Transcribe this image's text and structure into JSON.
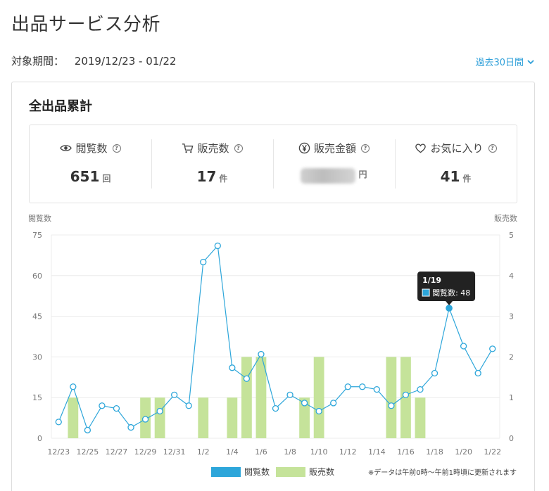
{
  "header": {
    "title": "出品サービス分析",
    "period_label": "対象期間：",
    "period_value": "2019/12/23 - 01/22",
    "range_selector": "過去30日間"
  },
  "card": {
    "title": "全出品累計",
    "stats": [
      {
        "icon": "eye-icon",
        "label": "閲覧数",
        "value": "651",
        "unit": "回"
      },
      {
        "icon": "cart-icon",
        "label": "販売数",
        "value": "17",
        "unit": "件"
      },
      {
        "icon": "yen-icon",
        "label": "販売金額",
        "value": "",
        "unit": "円"
      },
      {
        "icon": "heart-icon",
        "label": "お気に入り",
        "value": "41",
        "unit": "件"
      }
    ]
  },
  "chart_data": {
    "type": "bar",
    "x": [
      "12/23",
      "12/24",
      "12/25",
      "12/26",
      "12/27",
      "12/28",
      "12/29",
      "12/30",
      "12/31",
      "1/1",
      "1/2",
      "1/3",
      "1/4",
      "1/5",
      "1/6",
      "1/7",
      "1/8",
      "1/9",
      "1/10",
      "1/11",
      "1/12",
      "1/13",
      "1/14",
      "1/15",
      "1/16",
      "1/17",
      "1/18",
      "1/19",
      "1/20",
      "1/21",
      "1/22"
    ],
    "x_tick_labels": [
      "12/23",
      "12/25",
      "12/27",
      "12/29",
      "12/31",
      "1/2",
      "1/4",
      "1/6",
      "1/8",
      "1/10",
      "1/12",
      "1/14",
      "1/16",
      "1/18",
      "1/20",
      "1/22"
    ],
    "series": [
      {
        "name": "閲覧数",
        "type": "line",
        "axis": "left",
        "color": "#2da6da",
        "values": [
          6,
          19,
          3,
          12,
          11,
          4,
          7,
          10,
          16,
          12,
          65,
          71,
          26,
          22,
          31,
          11,
          16,
          13,
          10,
          13,
          19,
          19,
          18,
          12,
          16,
          18,
          24,
          48,
          34,
          24,
          33
        ]
      },
      {
        "name": "販売数",
        "type": "bar",
        "axis": "right",
        "color": "#c5e39a",
        "values": [
          0,
          1,
          0,
          0,
          0,
          0,
          1,
          1,
          0,
          0,
          1,
          0,
          1,
          2,
          2,
          0,
          0,
          1,
          2,
          0,
          0,
          0,
          0,
          2,
          2,
          1,
          0,
          0,
          0,
          0,
          0
        ]
      }
    ],
    "ylabel_left": "閲覧数",
    "ylabel_right": "販売数",
    "ylim_left": [
      0,
      75
    ],
    "ylim_right": [
      0,
      5
    ],
    "yticks_left": [
      0,
      15,
      30,
      45,
      60,
      75
    ],
    "yticks_right": [
      0,
      1,
      2,
      3,
      4,
      5
    ],
    "grid": true,
    "legend_placement": "bottom-center",
    "tooltip": {
      "title": "1/19",
      "label": "閲覧数: 48",
      "index": 27
    },
    "note": "※データは午前0時〜午前1時頃に更新されます"
  }
}
